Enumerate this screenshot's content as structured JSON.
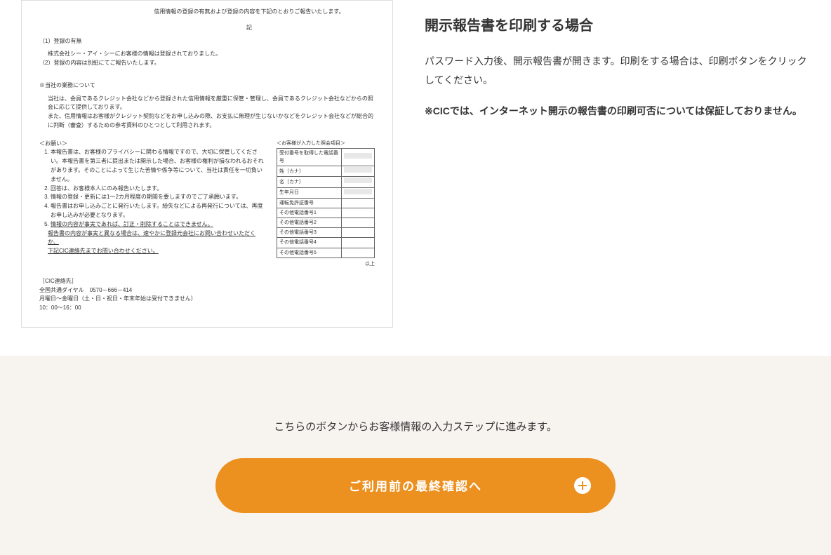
{
  "document": {
    "header": "信用情報の登録の有無および登録の内容を下記のとおりご報告いたします。",
    "ki": "記",
    "section1_title": "（1）登録の有無",
    "section1_body": "株式会社シー・アイ・シーにお客様の情報は登録されておりました。",
    "section2_title": "（2）登録の内容は別紙にてご報告いたします。",
    "section3_title": "※当社の業務について",
    "section3_body1": "当社は、会員であるクレジット会社などから登録された信用情報を厳重に保管・管理し、会員であるクレジット会社などからの照会に応じて提供しております。",
    "section3_body2": "また、信用情報はお客様がクレジット契約などをお申し込みの際、お支払に無理が生じないかなどをクレジット会社などが総合的に判断（審査）するための参考資料のひとつとして利用されます。",
    "notes_title": "＜お願い＞",
    "notes": [
      "本報告書は、お客様のプライバシーに関わる情報ですので、大切に保管してください。本報告書を第三者に提出または開示した場合、お客様の権利が損なわれるおそれがあります。そのことによって生じた苦情や係争等について、当社は責任を一切負いません。",
      "回答は、お客様本人にのみ報告いたします。",
      "情報の登録・更新には1～2カ月程度の期間を要しますのでご了承願います。",
      "報告書はお申し込みごとに発行いたします。紛失などによる再発行については、再度お申し込みが必要となります。",
      "情報の内容が事実であれば、訂正・削除することはできません。"
    ],
    "notes_footer1": "報告書の内容が事実と異なる場合は、速やかに登録元会社にお問い合わせいただくか、",
    "notes_footer2": "下記CIC連絡先までお問い合わせください。",
    "table_header": "＜お客様が入力した照会項目＞",
    "table_rows": [
      "受付番号を取得した電話番号",
      "姓〔カナ〕",
      "名〔カナ〕",
      "生年月日",
      "運転免許証番号",
      "その他電話番号1",
      "その他電話番号2",
      "その他電話番号3",
      "その他電話番号4",
      "その他電話番号5"
    ],
    "ijou": "以上",
    "contact_title": "［CIC連絡先］",
    "contact_phone": "全国共通ダイヤル　0570－666－414",
    "contact_hours1": "月曜日～金曜日（土・日・祝日・年末年始は受付できません）",
    "contact_hours2": "10：00～16：00"
  },
  "right": {
    "heading": "開示報告書を印刷する場合",
    "body": "パスワード入力後、開示報告書が開きます。印刷をする場合は、印刷ボタンをクリックしてください。",
    "notice": "※CICでは、インターネット開示の報告書の印刷可否については保証しておりません。"
  },
  "cta": {
    "lead": "こちらのボタンからお客様情報の入力ステップに進みます。",
    "button_label": "ご利用前の最終確認へ"
  }
}
